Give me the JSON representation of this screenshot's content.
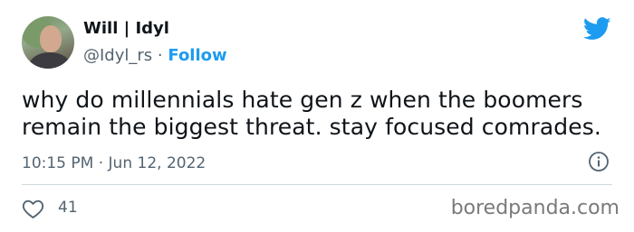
{
  "author": {
    "display_name": "Will | Idyl",
    "handle": "@Idyl_rs",
    "separator": "·",
    "follow_label": "Follow"
  },
  "tweet": {
    "text": "why do millennials hate gen z when the boomers remain the biggest threat. stay focused comrades.",
    "time": "10:15 PM",
    "date_separator": "·",
    "date": "Jun 12, 2022",
    "likes": "41"
  },
  "watermark": "boredpanda.com",
  "colors": {
    "accent": "#1d9bf0",
    "text": "#0f1419",
    "secondary": "#536471",
    "divider": "#cfd9de"
  },
  "icons": {
    "brand": "twitter-bird-icon",
    "info": "info-icon",
    "like": "heart-icon"
  }
}
